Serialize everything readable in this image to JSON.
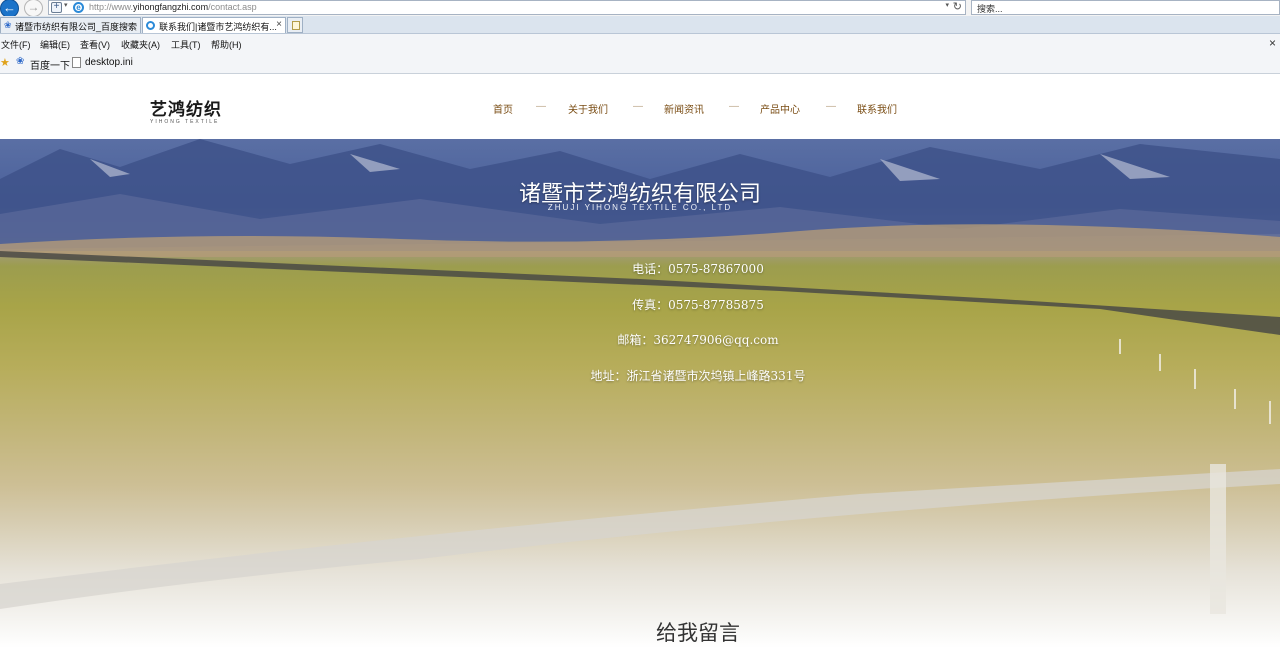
{
  "browser": {
    "url_prefix": "http://www.",
    "url_domain": "yihongfangzhi.com",
    "url_path": "/contact.asp",
    "search_placeholder": "搜索...",
    "tabs": [
      {
        "label": "诸暨市纺织有限公司_百度搜索",
        "active": false
      },
      {
        "label": "联系我们|诸暨市艺鸿纺织有...",
        "active": true
      }
    ],
    "menu": [
      "文件(F)",
      "编辑(E)",
      "查看(V)",
      "收藏夹(A)",
      "工具(T)",
      "帮助(H)"
    ],
    "favorites": [
      "百度一下",
      "desktop.ini"
    ]
  },
  "site": {
    "logo_cn": "艺鸿纺织",
    "logo_en": "YIHONG TEXTILE",
    "nav": [
      "首页",
      "关于我们",
      "新闻资讯",
      "产品中心",
      "联系我们"
    ],
    "nav_separator": "—",
    "hero": {
      "title": "诸暨市艺鸿纺织有限公司",
      "subtitle": "ZHUJI YIHONG TEXTILE CO., LTD",
      "phone": "电话：0575-87867000",
      "fax": "传真：0575-87785875",
      "email": "邮箱：362747906@qq.com",
      "address": "地址：浙江省诸暨市次坞镇上峰路331号"
    },
    "message_title": "给我留言"
  },
  "colors": {
    "nav_text": "#7a4d14",
    "browser_accent": "#1b73c9"
  }
}
